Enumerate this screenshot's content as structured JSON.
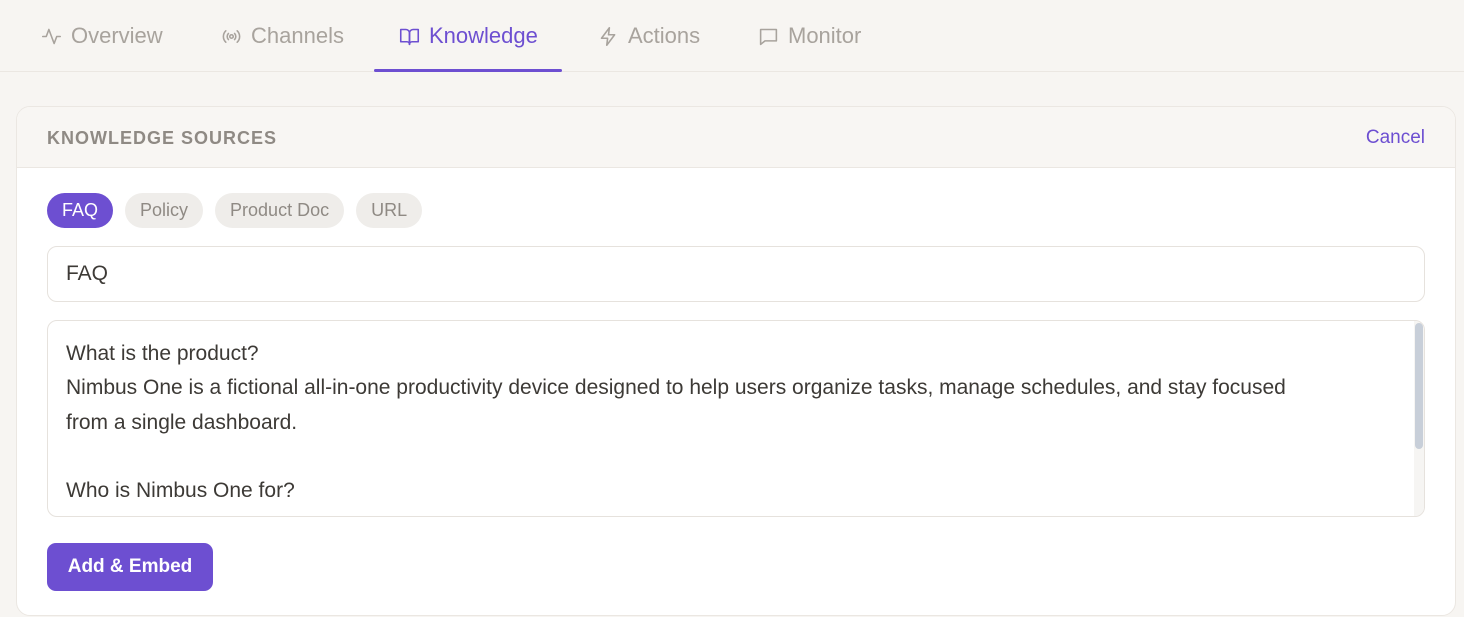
{
  "tabs": [
    {
      "label": "Overview",
      "icon": "activity-icon",
      "active": false
    },
    {
      "label": "Channels",
      "icon": "broadcast-icon",
      "active": false
    },
    {
      "label": "Knowledge",
      "icon": "book-open-icon",
      "active": true
    },
    {
      "label": "Actions",
      "icon": "lightning-icon",
      "active": false
    },
    {
      "label": "Monitor",
      "icon": "message-square-icon",
      "active": false
    }
  ],
  "panel": {
    "title": "KNOWLEDGE SOURCES",
    "cancel_label": "Cancel",
    "source_types": [
      {
        "label": "FAQ",
        "selected": true
      },
      {
        "label": "Policy",
        "selected": false
      },
      {
        "label": "Product Doc",
        "selected": false
      },
      {
        "label": "URL",
        "selected": false
      }
    ],
    "title_input_value": "FAQ",
    "content_value": "What is the product?\nNimbus One is a fictional all-in-one productivity device designed to help users organize tasks, manage schedules, and stay focused\nfrom a single dashboard.\n\nWho is Nimbus One for?",
    "submit_label": "Add & Embed"
  },
  "colors": {
    "accent": "#6d4fd1",
    "background": "#f7f5f2",
    "muted_text": "#a8a39d"
  }
}
